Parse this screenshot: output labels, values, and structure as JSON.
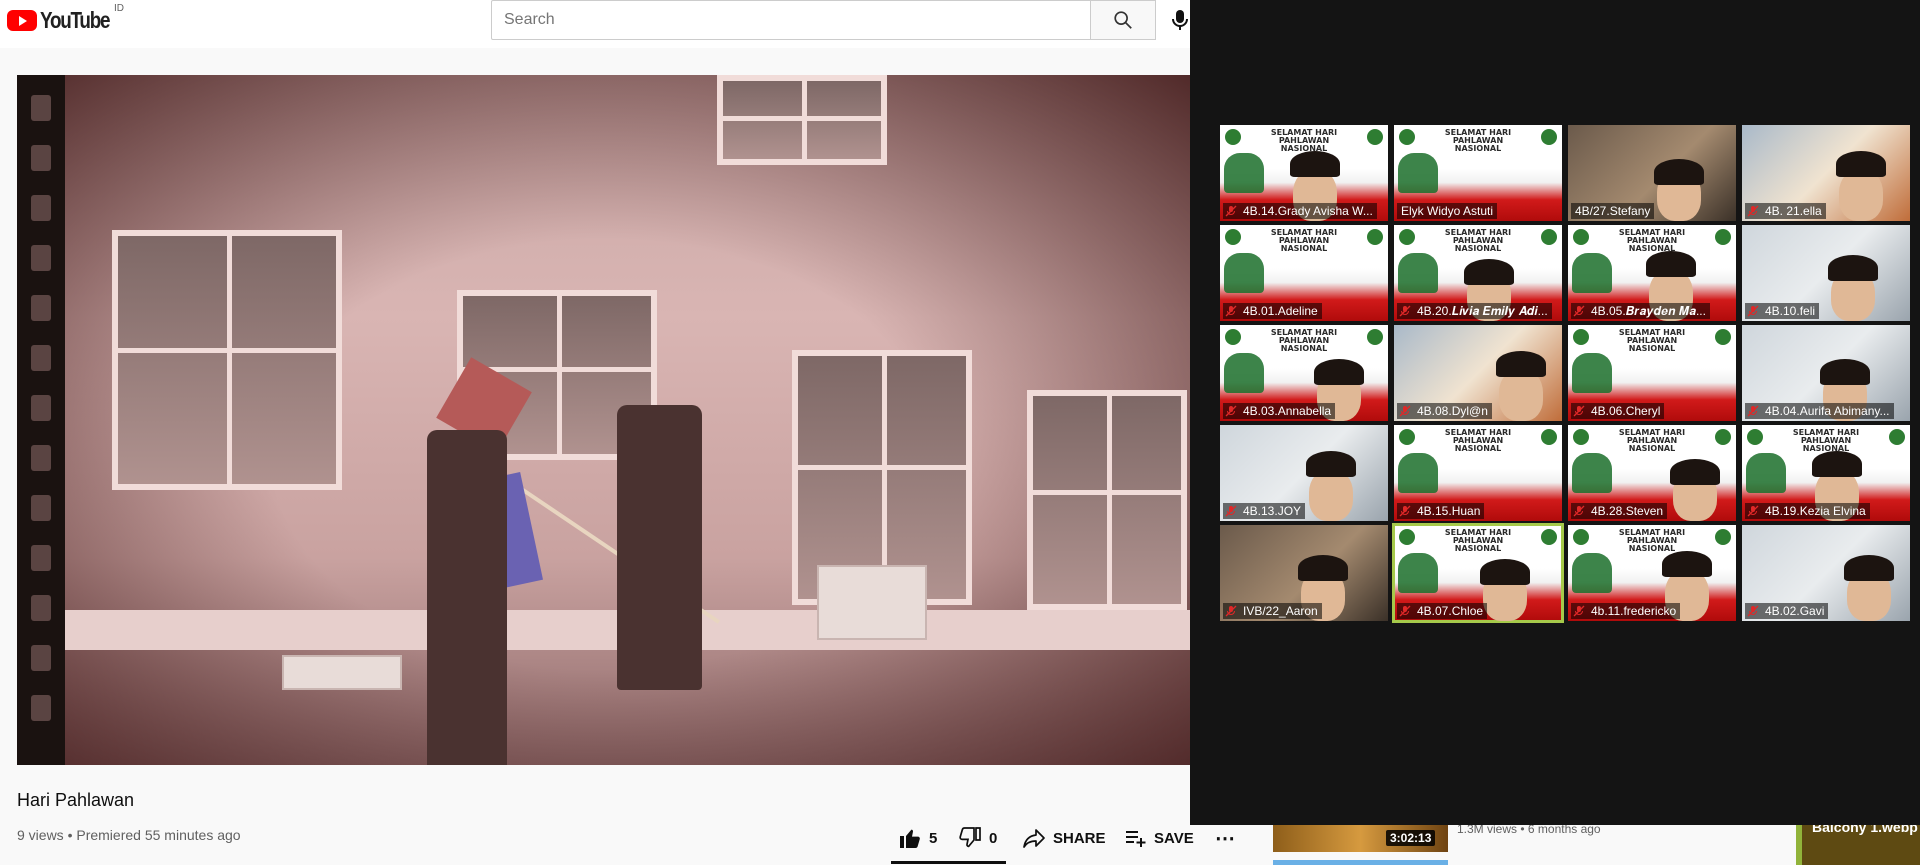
{
  "header": {
    "logo_text": "YouTube",
    "country_code": "ID",
    "search_placeholder": "Search"
  },
  "video": {
    "title": "Hari Pahlawan",
    "meta": "9 views • Premiered 55 minutes ago",
    "likes": "5",
    "dislikes": "0",
    "share_label": "SHARE",
    "save_label": "SAVE",
    "more_label": "⋯"
  },
  "recommendations": [
    {
      "duration": "3:02:13",
      "meta": "1.3M views • 6 months ago"
    },
    {
      "title": "Balcony 1.webp"
    }
  ],
  "zoom": {
    "participants": [
      {
        "name": "4B.14.Grady Avisha W...",
        "muted": true,
        "bg": "poster"
      },
      {
        "name": "Elyk Widyo Astuti",
        "muted": false,
        "bg": "poster"
      },
      {
        "name": "4B/27.Stefany",
        "muted": false,
        "bg": "cam"
      },
      {
        "name": "4B. 21.ella",
        "muted": true,
        "bg": "cam3"
      },
      {
        "name": "4B.01.Adeline",
        "muted": true,
        "bg": "poster"
      },
      {
        "name": "4B.20.𝑳𝒊𝒗𝒊𝒂 𝑬𝒎𝒊𝒍𝒚 𝑨𝒅𝒊...",
        "muted": true,
        "bg": "poster"
      },
      {
        "name": "4B.05.𝑩𝒓𝒂𝒚𝒅𝒆𝒏 𝑴𝒂...",
        "muted": true,
        "bg": "poster"
      },
      {
        "name": "4B.10.feli",
        "muted": true,
        "bg": "cam2"
      },
      {
        "name": "4B.03.Annabella",
        "muted": true,
        "bg": "poster"
      },
      {
        "name": "4B.08.Dyl@n",
        "muted": true,
        "bg": "cam3"
      },
      {
        "name": "4B.06.Cheryl",
        "muted": true,
        "bg": "poster"
      },
      {
        "name": "4B.04.Aurifa Abimany...",
        "muted": true,
        "bg": "cam2"
      },
      {
        "name": "4B.13.JOY",
        "muted": true,
        "bg": "cam2"
      },
      {
        "name": "4B.15.Huan",
        "muted": true,
        "bg": "poster"
      },
      {
        "name": "4B.28.Steven",
        "muted": true,
        "bg": "poster"
      },
      {
        "name": "4B.19.Kezia Elvina",
        "muted": true,
        "bg": "poster"
      },
      {
        "name": "IVB/22_Aaron",
        "muted": true,
        "bg": "cam"
      },
      {
        "name": "4B.07.Chloe",
        "muted": true,
        "bg": "poster",
        "active": true
      },
      {
        "name": "4b.11.fredericko",
        "muted": true,
        "bg": "poster"
      },
      {
        "name": "4B.02.Gavi",
        "muted": true,
        "bg": "cam2"
      }
    ],
    "poster_text": "SELAMAT HARI PAHLAWAN NASIONAL"
  },
  "colors": {
    "youtube_red": "#ff0000",
    "zoom_bg": "#141414",
    "active_speaker": "#a6c94a"
  }
}
